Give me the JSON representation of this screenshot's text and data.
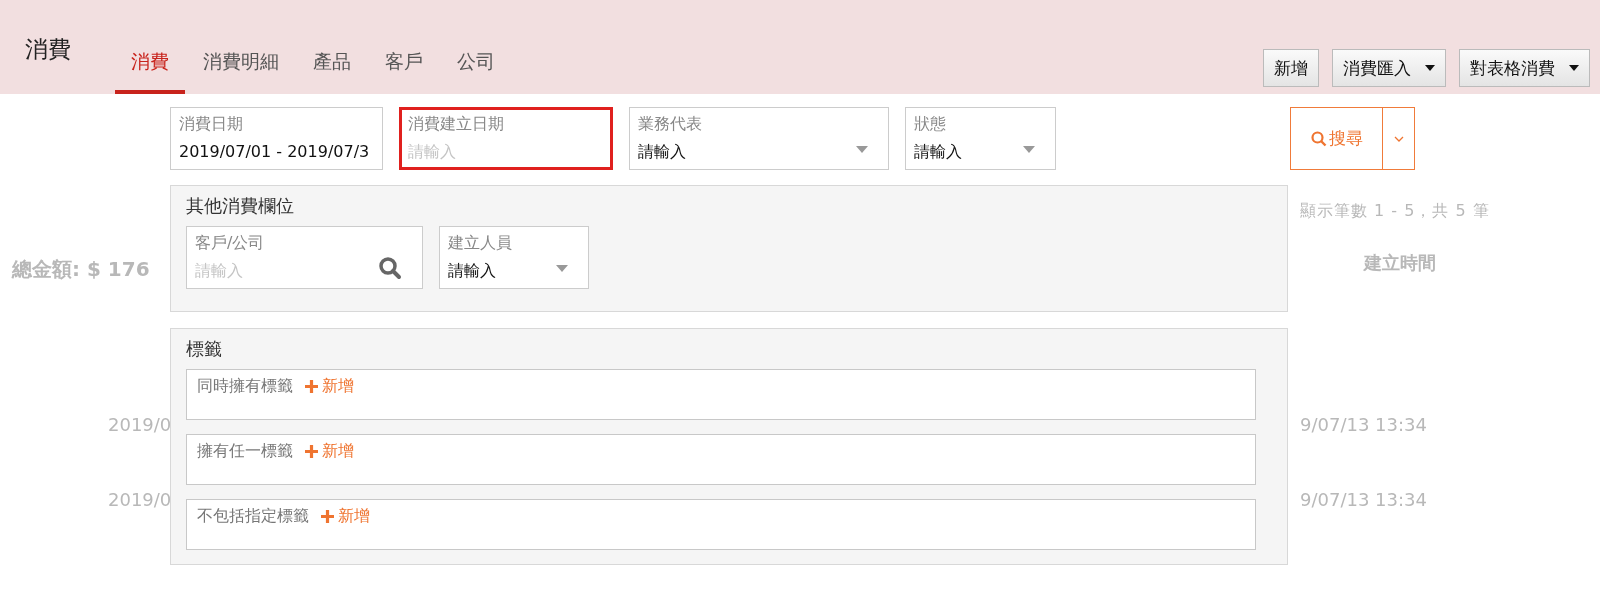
{
  "header": {
    "title": "消費",
    "tabs": [
      {
        "label": "消費",
        "selected": true
      },
      {
        "label": "消費明細",
        "selected": false
      },
      {
        "label": "產品",
        "selected": false
      },
      {
        "label": "客戶",
        "selected": false
      },
      {
        "label": "公司",
        "selected": false
      }
    ],
    "actions": [
      {
        "label": "新增",
        "dropdown": false
      },
      {
        "label": "消費匯入",
        "dropdown": true
      },
      {
        "label": "對表格消費",
        "dropdown": true
      }
    ]
  },
  "background": {
    "total": "總金額: $ 176",
    "count": "顯示筆數 1 - 5，共 5 筆",
    "column": "建立時間",
    "rows": [
      {
        "date": "2019/0",
        "time": "9/07/13 13:34"
      },
      {
        "date": "2019/0",
        "time": "9/07/13 13:34"
      }
    ]
  },
  "filters": [
    {
      "label": "消費日期",
      "value": "2019/07/01 - 2019/07/3",
      "kind": "text",
      "highlighted": false
    },
    {
      "label": "消費建立日期",
      "placeholder": "請輸入",
      "kind": "text",
      "highlighted": true
    },
    {
      "label": "業務代表",
      "value": "請輸入",
      "kind": "select",
      "highlighted": false
    },
    {
      "label": "狀態",
      "value": "請輸入",
      "kind": "select",
      "highlighted": false
    }
  ],
  "search_button": "搜尋",
  "other_fields": {
    "title": "其他消費欄位",
    "fields": [
      {
        "label": "客戶/公司",
        "placeholder": "請輸入",
        "kind": "search"
      },
      {
        "label": "建立人員",
        "value": "請輸入",
        "kind": "select"
      }
    ]
  },
  "tags": {
    "title": "標籤",
    "groups": [
      {
        "label": "同時擁有標籤",
        "add": "新增"
      },
      {
        "label": "擁有任一標籤",
        "add": "新增"
      },
      {
        "label": "不包括指定標籤",
        "add": "新增"
      }
    ]
  }
}
